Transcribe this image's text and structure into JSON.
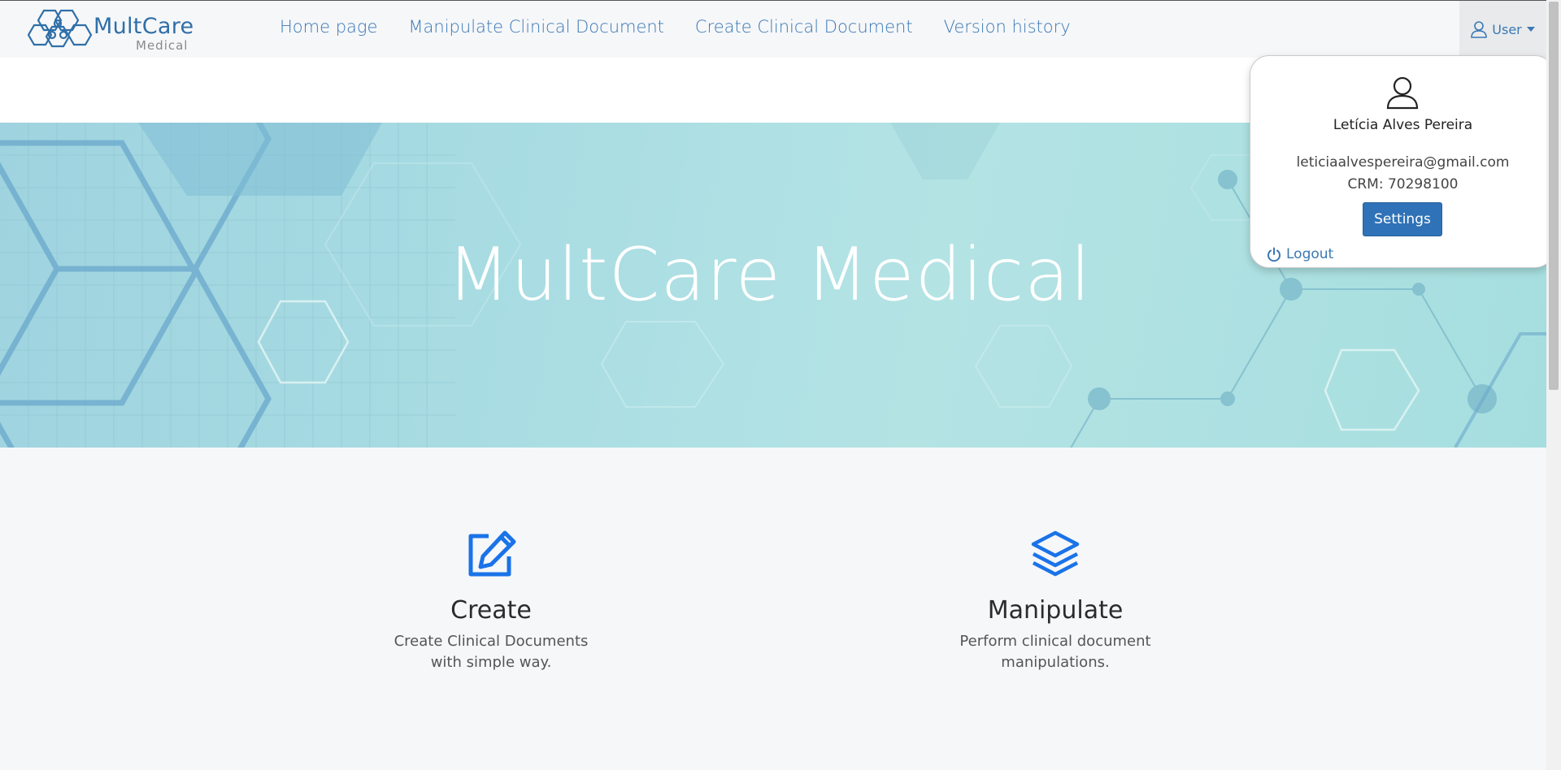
{
  "brand": {
    "name": "MultCare",
    "sub": "Medical"
  },
  "nav": {
    "links": [
      {
        "label": "Home page"
      },
      {
        "label": "Manipulate Clinical Document"
      },
      {
        "label": "Create Clinical Document"
      },
      {
        "label": "Version history"
      }
    ],
    "user_label": "User"
  },
  "hero": {
    "title": "MultCare Medical"
  },
  "features": [
    {
      "title": "Create",
      "line1": "Create Clinical Documents",
      "line2": "with simple way.",
      "icon": "edit-icon"
    },
    {
      "title": "Manipulate",
      "line1": "Perform clinical document",
      "line2": "manipulations.",
      "icon": "layers-icon"
    }
  ],
  "user_menu": {
    "name": "Letícia Alves Pereira",
    "email": "leticiaalvespereira@gmail.com",
    "crm": "CRM: 70298100",
    "settings_label": "Settings",
    "logout_label": "Logout"
  },
  "colors": {
    "accent": "#3a78b4",
    "button": "#2f72b7",
    "icon_blue": "#1a73e8"
  }
}
